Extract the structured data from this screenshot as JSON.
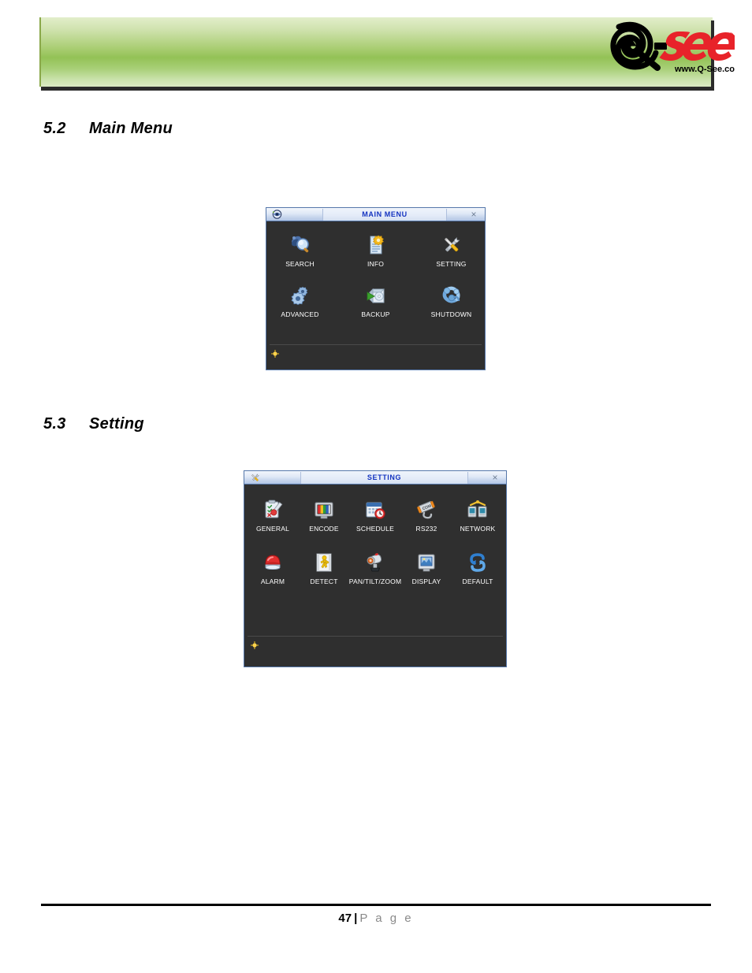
{
  "header": {
    "logo": {
      "brand_q": "Q",
      "brand_dash": "-",
      "brand_see": "See",
      "registered_mark": "®",
      "website": "www.Q-See.com",
      "color_red": "#e8232a",
      "color_black": "#000000",
      "band_color_light": "#dceac4",
      "band_color_mid": "#93c256"
    }
  },
  "sections": [
    {
      "number": "5.2",
      "title": "Main Menu"
    },
    {
      "number": "5.3",
      "title": "Setting"
    }
  ],
  "main_menu_dialog": {
    "title": "MAIN MENU",
    "title_icon": "dvr-menu-icon",
    "close_label": "×",
    "status_icon": "bulb-icon",
    "rows": [
      [
        {
          "label": "SEARCH",
          "icon": "magnifier-icon"
        },
        {
          "label": "INFO",
          "icon": "document-gear-icon"
        },
        {
          "label": "SETTING",
          "icon": "wrench-screwdriver-icon"
        }
      ],
      [
        {
          "label": "ADVANCED",
          "icon": "gears-icon"
        },
        {
          "label": "BACKUP",
          "icon": "backup-disc-icon"
        },
        {
          "label": "SHUTDOWN",
          "icon": "power-icon"
        }
      ]
    ]
  },
  "setting_dialog": {
    "title": "SETTING",
    "title_icon": "wrench-screwdriver-icon",
    "close_label": "×",
    "status_icon": "bulb-icon",
    "rows": [
      [
        {
          "label": "GENERAL",
          "icon": "clipboard-pen-icon"
        },
        {
          "label": "ENCODE",
          "icon": "monitor-colorbars-icon"
        },
        {
          "label": "SCHEDULE",
          "icon": "calendar-clock-icon"
        },
        {
          "label": "RS232",
          "icon": "com-port-icon"
        },
        {
          "label": "NETWORK",
          "icon": "network-computers-icon"
        }
      ],
      [
        {
          "label": "ALARM",
          "icon": "alarm-dome-icon"
        },
        {
          "label": "DETECT",
          "icon": "walking-person-icon"
        },
        {
          "label": "PAN/TILT/ZOOM",
          "icon": "ptz-camera-icon"
        },
        {
          "label": "DISPLAY",
          "icon": "display-monitor-icon"
        },
        {
          "label": "DEFAULT",
          "icon": "refresh-arrows-icon"
        }
      ]
    ]
  },
  "footer": {
    "page_number": "47",
    "separator": "|",
    "page_word": "P a g e"
  }
}
